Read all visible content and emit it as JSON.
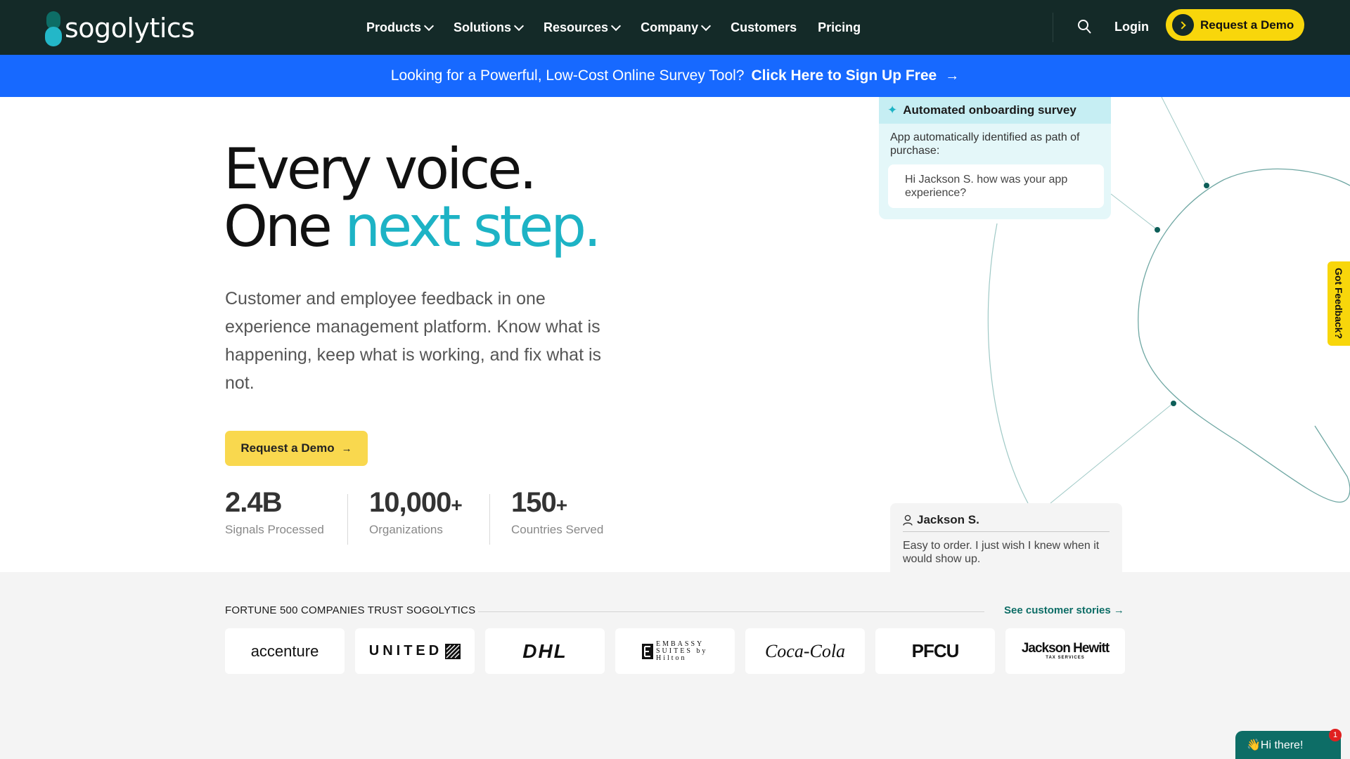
{
  "nav": {
    "logo_text": "sogolytics",
    "items": [
      {
        "label": "Products",
        "dropdown": true
      },
      {
        "label": "Solutions",
        "dropdown": true
      },
      {
        "label": "Resources",
        "dropdown": true
      },
      {
        "label": "Company",
        "dropdown": true
      },
      {
        "label": "Customers",
        "dropdown": false
      },
      {
        "label": "Pricing",
        "dropdown": false
      }
    ],
    "login_label": "Login",
    "demo_label": "Request a Demo"
  },
  "banner": {
    "text": "Looking for a Powerful, Low-Cost Online Survey Tool?",
    "cta": "Click Here to Sign Up Free",
    "arrow": "→"
  },
  "hero": {
    "line1": "Every voice.",
    "line2_plain": "One ",
    "line2_accent": "next step.",
    "subtitle": "Customer and employee feedback in one experience management platform. Know what is happening, keep what is working, and fix what is not.",
    "button_label": "Request a Demo",
    "button_arrow": "→",
    "stats": [
      {
        "value": "2.4B",
        "suffix": "",
        "label": "Signals Processed"
      },
      {
        "value": "10,000",
        "suffix": "+",
        "label": "Organizations"
      },
      {
        "value": "150",
        "suffix": "+",
        "label": "Countries Served"
      }
    ]
  },
  "survey_card": {
    "title": "Automated onboarding survey",
    "text": "App automatically identified as path of purchase:",
    "bubble": "Hi Jackson S. how was your app experience?"
  },
  "review_card": {
    "name": "Jackson S.",
    "text": "Easy to order. I just wish I knew when it would show up."
  },
  "feedback_tab": "Got Feedback?",
  "trust": {
    "title": "FORTUNE 500 COMPANIES TRUST SOGOLYTICS",
    "stories_label": "See customer stories",
    "stories_arrow": "→",
    "logos": [
      "accenture",
      "UNITED",
      "DHL",
      "EMBASSY SUITES by Hilton",
      "Coca-Cola",
      "PFCU",
      "Jackson Hewitt",
      "TAX SERVICES"
    ]
  },
  "chat": {
    "label": "👋Hi there!",
    "badge": "1"
  },
  "colors": {
    "nav_bg": "#142a28",
    "banner_bg": "#1769ff",
    "accent_teal": "#1db3c5",
    "brand_yellow": "#f8d60b",
    "dark_teal": "#0d6d66"
  }
}
